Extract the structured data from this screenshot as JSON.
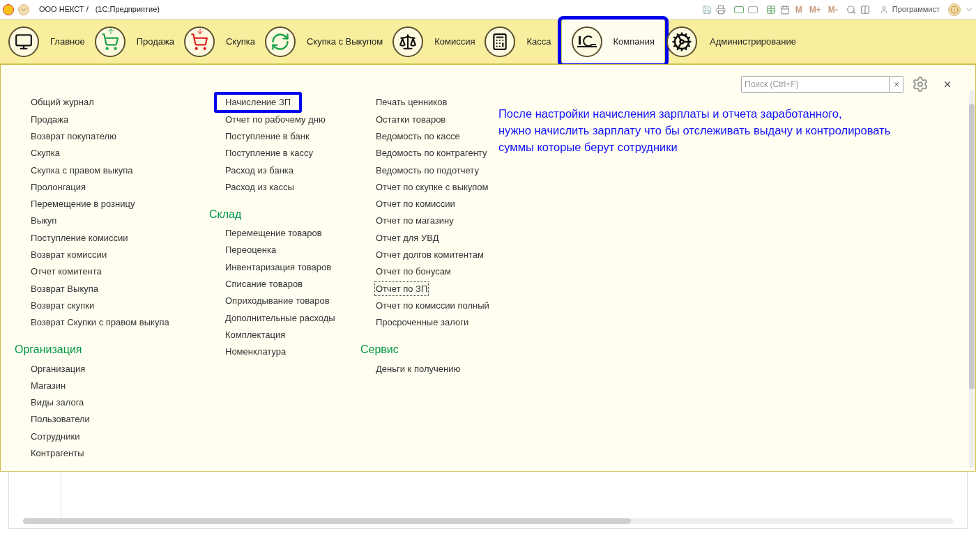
{
  "title_bar": {
    "title": "ООО НЕКСТ /",
    "subtitle": "(1С:Предприятие)",
    "memory_buttons": [
      "M",
      "M+",
      "M-"
    ],
    "user": "Программист"
  },
  "sections": [
    {
      "label": "Главное",
      "selected": false,
      "highlighted": false
    },
    {
      "label": "Продажа",
      "selected": false,
      "highlighted": false
    },
    {
      "label": "Скупка",
      "selected": false,
      "highlighted": false
    },
    {
      "label": "Скупка с Выкупом",
      "selected": false,
      "highlighted": false
    },
    {
      "label": "Комиссия",
      "selected": false,
      "highlighted": false
    },
    {
      "label": "Касса",
      "selected": false,
      "highlighted": false
    },
    {
      "label": "Компания",
      "selected": true,
      "highlighted": true
    },
    {
      "label": "Администрирование",
      "selected": false,
      "highlighted": false
    }
  ],
  "search": {
    "placeholder": "Поиск (Ctrl+F)"
  },
  "columns": [
    {
      "groups": [
        {
          "items": [
            {
              "label": "Общий журнал",
              "highlighted": false,
              "focused": false
            },
            {
              "label": "Продажа",
              "highlighted": false,
              "focused": false
            },
            {
              "label": "Возврат покупателю",
              "highlighted": false,
              "focused": false
            },
            {
              "label": "Скупка",
              "highlighted": false,
              "focused": false
            },
            {
              "label": "Скупка с правом выкупа",
              "highlighted": false,
              "focused": false
            },
            {
              "label": "Пролонгация",
              "highlighted": false,
              "focused": false
            },
            {
              "label": "Перемещение в розницу",
              "highlighted": false,
              "focused": false
            },
            {
              "label": "Выкуп",
              "highlighted": false,
              "focused": false
            },
            {
              "label": "Поступление комиссии",
              "highlighted": false,
              "focused": false
            },
            {
              "label": "Возврат комиссии",
              "highlighted": false,
              "focused": false
            },
            {
              "label": "Отчет комитента",
              "highlighted": false,
              "focused": false
            },
            {
              "label": "Возврат Выкупа",
              "highlighted": false,
              "focused": false
            },
            {
              "label": "Возврат скупки",
              "highlighted": false,
              "focused": false
            },
            {
              "label": "Возврат Скупки с правом выкупа",
              "highlighted": false,
              "focused": false
            }
          ]
        },
        {
          "title": "Организация",
          "items": [
            {
              "label": "Организация",
              "highlighted": false,
              "focused": false
            },
            {
              "label": "Магазин",
              "highlighted": false,
              "focused": false
            },
            {
              "label": "Виды залога",
              "highlighted": false,
              "focused": false
            },
            {
              "label": "Пользователи",
              "highlighted": false,
              "focused": false
            },
            {
              "label": "Сотрудники",
              "highlighted": false,
              "focused": false
            },
            {
              "label": "Контрагенты",
              "highlighted": false,
              "focused": false
            }
          ]
        }
      ]
    },
    {
      "groups": [
        {
          "items": [
            {
              "label": "Начисление ЗП",
              "highlighted": true,
              "focused": false
            },
            {
              "label": "Отчет по рабочему дню",
              "highlighted": false,
              "focused": false
            },
            {
              "label": "Поступление в банк",
              "highlighted": false,
              "focused": false
            },
            {
              "label": "Поступление в кассу",
              "highlighted": false,
              "focused": false
            },
            {
              "label": "Расход из банка",
              "highlighted": false,
              "focused": false
            },
            {
              "label": "Расход из кассы",
              "highlighted": false,
              "focused": false
            }
          ]
        },
        {
          "title": "Склад",
          "items": [
            {
              "label": "Перемещение товаров",
              "highlighted": false,
              "focused": false
            },
            {
              "label": "Переоценка",
              "highlighted": false,
              "focused": false
            },
            {
              "label": "Инвентаризация товаров",
              "highlighted": false,
              "focused": false
            },
            {
              "label": "Списание товаров",
              "highlighted": false,
              "focused": false
            },
            {
              "label": "Оприходывание товаров",
              "highlighted": false,
              "focused": false
            },
            {
              "label": "Дополнительные расходы",
              "highlighted": false,
              "focused": false
            },
            {
              "label": "Комплектация",
              "highlighted": false,
              "focused": false
            },
            {
              "label": "Номенклатура",
              "highlighted": false,
              "focused": false
            }
          ]
        }
      ]
    },
    {
      "groups": [
        {
          "items": [
            {
              "label": "Печать ценников",
              "highlighted": false,
              "focused": false
            },
            {
              "label": "Остатки товаров",
              "highlighted": false,
              "focused": false
            },
            {
              "label": "Ведомость по кассе",
              "highlighted": false,
              "focused": false
            },
            {
              "label": "Ведомость по контрагенту",
              "highlighted": false,
              "focused": false
            },
            {
              "label": "Ведомость по подотчету",
              "highlighted": false,
              "focused": false
            },
            {
              "label": "Отчет по скупке с выкупом",
              "highlighted": false,
              "focused": false
            },
            {
              "label": "Отчет по комиссии",
              "highlighted": false,
              "focused": false
            },
            {
              "label": "Отчет по магазину",
              "highlighted": false,
              "focused": false
            },
            {
              "label": "Отчет для УВД",
              "highlighted": false,
              "focused": false
            },
            {
              "label": "Отчет долгов комитентам",
              "highlighted": false,
              "focused": false
            },
            {
              "label": "Отчет по бонусам",
              "highlighted": false,
              "focused": false
            },
            {
              "label": "Отчет по ЗП",
              "highlighted": false,
              "focused": true
            },
            {
              "label": "Отчет по комиссии полный",
              "highlighted": false,
              "focused": false
            },
            {
              "label": "Просроченные залоги",
              "highlighted": false,
              "focused": false
            }
          ]
        },
        {
          "title": "Сервис",
          "items": [
            {
              "label": "Деньги к получению",
              "highlighted": false,
              "focused": false
            }
          ]
        }
      ]
    }
  ],
  "annotation": {
    "lines": [
      "После настройки начисления зарплаты и отчета заработанного,",
      "нужно начислить зарплату что бы отслеживать выдачу и контролировать",
      "суммы которые берут сотрудники"
    ]
  }
}
